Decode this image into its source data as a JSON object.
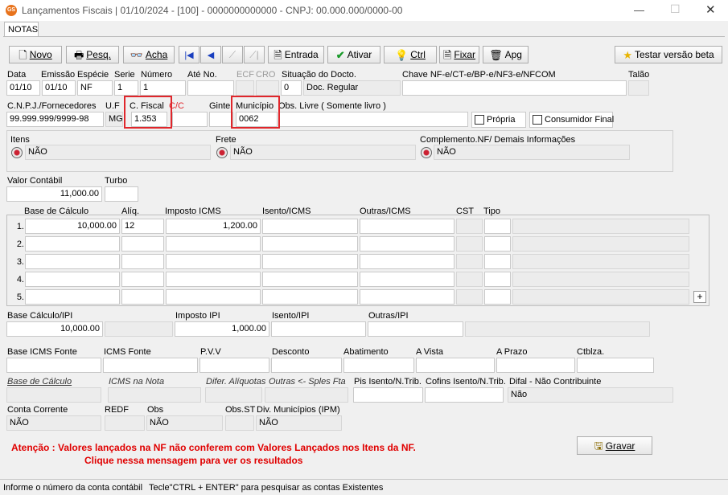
{
  "window": {
    "app_icon": "app-logo-icon",
    "title": "Lançamentos Fiscais |  01/10/2024 - [100] - 0000000000000 - CNPJ: 00.000.000/0000-00"
  },
  "tab": {
    "label": "NOTAS"
  },
  "toolbar": {
    "novo": "Novo",
    "pesq": "Pesq.",
    "acha": "Acha",
    "entrada": "Entrada",
    "ativar": "Ativar",
    "ctrl": "Ctrl",
    "fixar": "Fixar",
    "apg": "Apg",
    "testar": "Testar versão beta"
  },
  "header": {
    "data_label": "Data",
    "data": "01/10",
    "emissao_label": "Emissão",
    "emissao": "01/10",
    "especie_label": "Espécie",
    "especie": "NF",
    "serie_label": "Serie",
    "serie": "1",
    "numero_label": "Número",
    "numero": "1",
    "ate_label": "Até No.",
    "ate": "",
    "ecf_label": "ECF",
    "cro_label": "CRO",
    "situacao_label": "Situação do Docto.",
    "situacao_code": "0",
    "situacao_desc": "Doc. Regular",
    "chave_label": "Chave NF-e/CT-e/BP-e/NF3-e/NFCOM",
    "chave": "",
    "talao_label": "Talão",
    "talao": ""
  },
  "row2": {
    "cnpj_label": "C.N.P.J./Fornecedores",
    "cnpj": "99.999.999/9999-98",
    "uf_label": "U.F",
    "uf": "MG",
    "cfiscal_label": "C. Fiscal",
    "cfiscal": "1.353",
    "cc_label": "C/C",
    "cc": "",
    "ginte_label": "Ginte",
    "ginte": "",
    "municipio_label": "Município",
    "municipio": "0062",
    "obs_livre_label": "Obs. Livre ( Somente livro )",
    "obs_livre": "",
    "propria_label": "Própria",
    "consumidor_label": "Consumidor Final"
  },
  "group": {
    "itens_label": "Itens",
    "itens": "NÃO",
    "frete_label": "Frete",
    "frete": "NÃO",
    "complemento_label": "Complemento.NF/ Demais Informações",
    "complemento": "NÃO"
  },
  "valores": {
    "valor_contabil_label": "Valor Contábil",
    "valor_contabil": "11,000.00",
    "turbo_label": "Turbo",
    "turbo": ""
  },
  "icms_grid": {
    "headers": [
      "Base de Cálculo",
      "Alíq.",
      "Imposto ICMS",
      "Isento/ICMS",
      "Outras/ICMS",
      "CST",
      "Tipo"
    ],
    "rows": [
      {
        "num": "1.",
        "base": "10,000.00",
        "aliq": "12",
        "imposto": "1,200.00"
      },
      {
        "num": "2.",
        "base": "",
        "aliq": "",
        "imposto": ""
      },
      {
        "num": "3.",
        "base": "",
        "aliq": "",
        "imposto": ""
      },
      {
        "num": "4.",
        "base": "",
        "aliq": "",
        "imposto": ""
      },
      {
        "num": "5.",
        "base": "",
        "aliq": "",
        "imposto": ""
      }
    ],
    "add_label": "+"
  },
  "ipi": {
    "base_label": "Base Cálculo/IPI",
    "base": "10,000.00",
    "imposto_label": "Imposto IPI",
    "imposto": "1,000.00",
    "isento_label": "Isento/IPI",
    "outras_label": "Outras/IPI"
  },
  "fonte": {
    "base_icms_fonte_label": "Base ICMS Fonte",
    "icms_fonte_label": "ICMS Fonte",
    "pvv_label": "P.V.V",
    "desconto_label": "Desconto",
    "abatimento_label": "Abatimento",
    "avista_label": "A Vista",
    "aprazo_label": "A Prazo",
    "ctblza_label": "Ctblza."
  },
  "calc": {
    "base_label": "Base de Cálculo",
    "icms_nota_label": "ICMS na Nota",
    "difer_label": "Difer. Alíquotas",
    "outras_label": "Outras <- Sples Fta",
    "pis_label": "Pis Isento/N.Trib.",
    "cofins_label": "Cofins Isento/N.Trib.",
    "difal_label": "Difal - Não Contribuinte",
    "difal": "Não"
  },
  "conta": {
    "conta_label": "Conta Corrente",
    "conta": "NÃO",
    "redf_label": "REDF",
    "obs_label": "Obs",
    "obs": "NÃO",
    "obsst_label": "Obs.ST",
    "div_label": "Div. Municípios (IPM)",
    "div": "NÃO"
  },
  "alert": {
    "line1": "Atenção : Valores lançados na NF não conferem com Valores Lançados nos Itens da NF.",
    "line2": "Clique nessa mensagem para ver os resultados",
    "color": "#e00000"
  },
  "gravar_label": "Gravar",
  "status": {
    "left": "Informe o número da conta contábil",
    "right": "Tecle\"CTRL + ENTER\"  para pesquisar as contas Existentes"
  }
}
